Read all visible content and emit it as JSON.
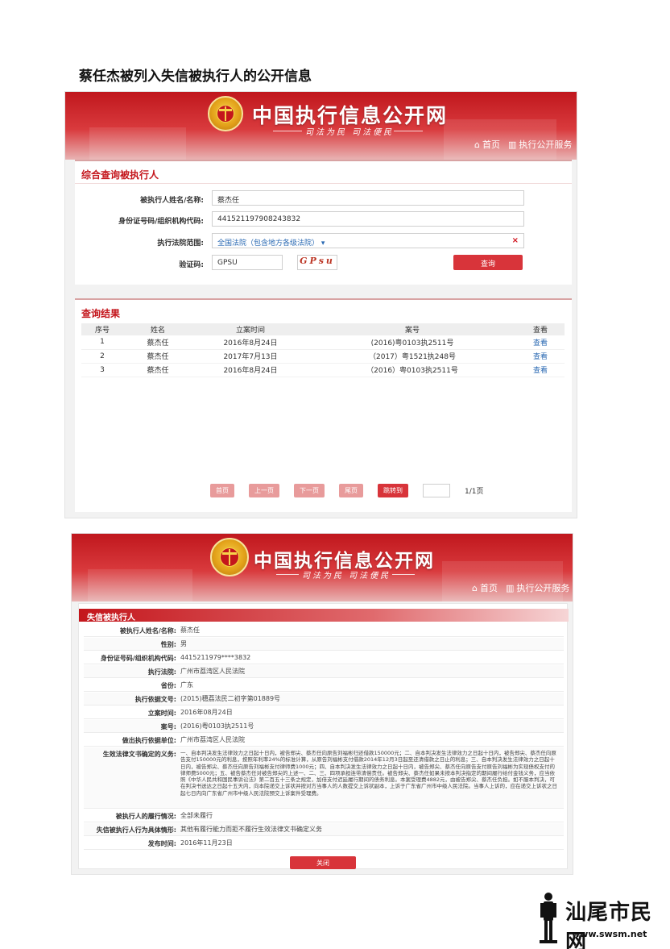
{
  "document_title": "蔡任杰被列入失信被执行人的公开信息",
  "site": {
    "name": "中国执行信息公开网",
    "slogan": "司法为民  司法便民",
    "nav": {
      "home": "首页",
      "service": "执行公开服务"
    }
  },
  "query_form": {
    "title": "综合查询被执行人",
    "fields": [
      {
        "label": "被执行人姓名/名称:",
        "value": "蔡杰任"
      },
      {
        "label": "身份证号码/组织机构代码:",
        "value": "441521197908243832"
      },
      {
        "label": "执行法院范围:",
        "value": "全国法院（包含地方各级法院）"
      },
      {
        "label": "验证码:",
        "value": "GPSU"
      }
    ],
    "captcha_text": "GPsu",
    "clear_symbol": "×",
    "submit_label": "查询"
  },
  "results": {
    "title": "查询结果",
    "columns": [
      "序号",
      "姓名",
      "立案时间",
      "案号",
      "查看"
    ],
    "rows": [
      [
        "1",
        "蔡杰任",
        "2016年8月24日",
        "(2016)粤0103执2511号",
        "查看"
      ],
      [
        "2",
        "蔡杰任",
        "2017年7月13日",
        "（2017）粤1521执248号",
        "查看"
      ],
      [
        "3",
        "蔡杰任",
        "2016年8月24日",
        "（2016）粤0103执2511号",
        "查看"
      ]
    ],
    "pager": {
      "first": "首页",
      "prev": "上一页",
      "next": "下一页",
      "last": "尾页",
      "goto": "跳转到",
      "pages": "1/1页"
    }
  },
  "detail": {
    "title": "失信被执行人",
    "rows": [
      {
        "label": "被执行人姓名/名称:",
        "value": "蔡杰任"
      },
      {
        "label": "性别:",
        "value": "男"
      },
      {
        "label": "身份证号码/组织机构代码:",
        "value": "4415211979****3832"
      },
      {
        "label": "执行法院:",
        "value": "广州市荔湾区人民法院"
      },
      {
        "label": "省份:",
        "value": "广东"
      },
      {
        "label": "执行依据文号:",
        "value": "(2015)穗荔法民二初字第01889号"
      },
      {
        "label": "立案时间:",
        "value": "2016年08月24日"
      },
      {
        "label": "案号:",
        "value": "(2016)粤0103执2511号"
      },
      {
        "label": "做出执行依据单位:",
        "value": "广州市荔湾区人民法院"
      },
      {
        "label": "生效法律文书确定的义务:",
        "value": "一、自本判决发生法律效力之日起十日内，被告郑尖、蔡杰任向原告刘福彬归还借款150000元；二、自本判决发生法律效力之日起十日内，被告郑尖、蔡杰任向原告支付150000元的利息，按照年利率24%的标准计算，从原告刘福彬支付借款2014年12月3日起至还清借款之日止的利息；三、自本判决发生法律效力之日起十日内，被告郑尖、蔡杰任向原告刘福彬支付律师费1000元；四、自本判决发生法律效力之日起十日内，被告郑尖、蔡杰任向原告支付原告刘福彬为实现债权支付的律师费5000元；五、被告蔡杰任对被告郑尖的上述一、二、三、四项承担连带清偿责任。被告郑尖、蔡杰任如果未按本判决指定的期间履行给付金钱义务，应当依照《中华人民共和国民事诉讼法》第二百五十三条之规定，加倍支付迟延履行期间的债务利息。本案受理费4882元，由被告郑尖、蔡杰任负担。如不服本判决，可在判决书送达之日起十五天内，向本院递交上诉状并按对方当事人的人数提交上诉状副本，上诉于广东省广州市中级人民法院。当事人上诉的，应在递交上诉状之日起七日内向广东省广州市中级人民法院预交上诉案件受理费。"
      },
      {
        "label": "被执行人的履行情况:",
        "value": "全部未履行"
      },
      {
        "label": "失信被执行人行为具体情形:",
        "value": "其他有履行能力而拒不履行生效法律文书确定义务"
      },
      {
        "label": "发布时间:",
        "value": "2016年11月23日"
      }
    ],
    "close_label": "关闭"
  },
  "watermark": {
    "name": "汕尾市民网",
    "url": "www.swsm.net"
  }
}
